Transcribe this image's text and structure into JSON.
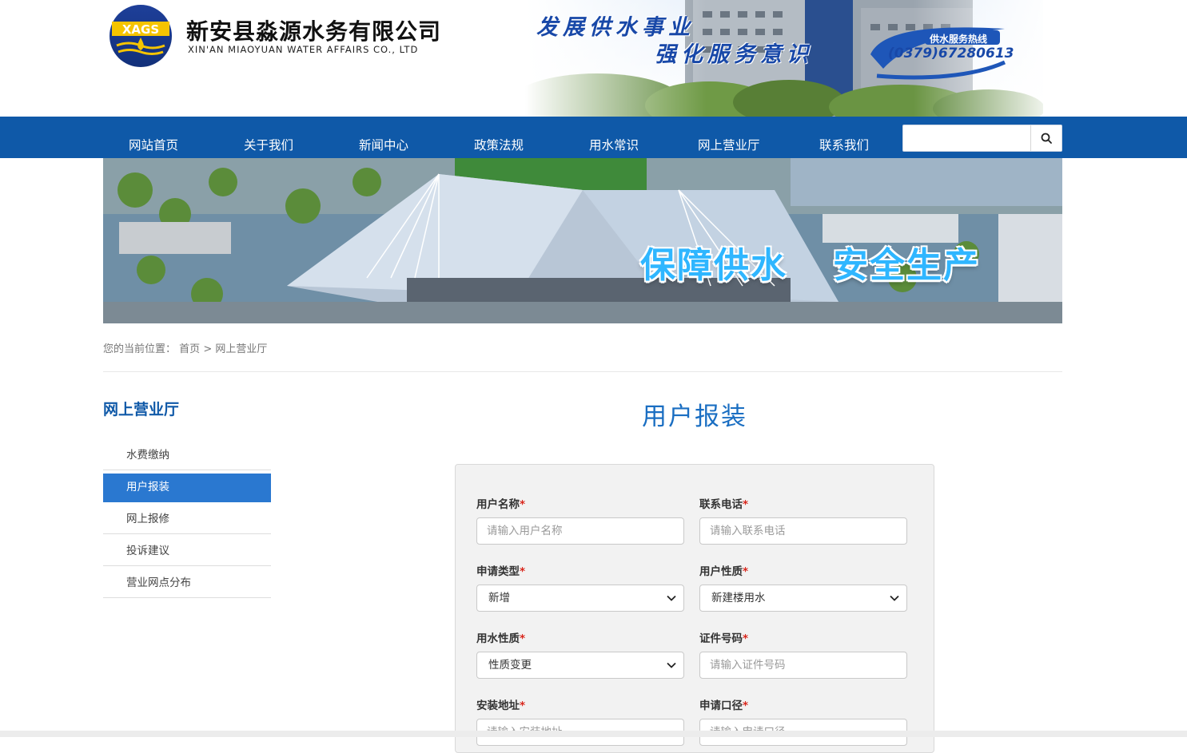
{
  "header": {
    "logo_text": "XAGS",
    "company_cn": "新安县淼源水务有限公司",
    "company_en": "XIN'AN MIAOYUAN WATER AFFAIRS CO., LTD",
    "slogan_line1": "发展供水事业",
    "slogan_line2": "强化服务意识",
    "hotline_label": "供水服务热线",
    "hotline_number": "(0379)67280613"
  },
  "nav": {
    "items": [
      "网站首页",
      "关于我们",
      "新闻中心",
      "政策法规",
      "用水常识",
      "网上营业厅",
      "联系我们"
    ],
    "search_value": "",
    "search_icon": "search-icon"
  },
  "banner": {
    "text_left": "保障供水",
    "text_right": "安全生产"
  },
  "breadcrumb": {
    "prefix": "您的当前位置：",
    "home": "首页",
    "separator": ">",
    "current": "网上营业厅"
  },
  "sidebar": {
    "title": "网上营业厅",
    "items": [
      {
        "label": "水费缴纳",
        "active": false
      },
      {
        "label": "用户报装",
        "active": true
      },
      {
        "label": "网上报修",
        "active": false
      },
      {
        "label": "投诉建议",
        "active": false
      },
      {
        "label": "营业网点分布",
        "active": false
      }
    ]
  },
  "main": {
    "title": "用户报装",
    "required_mark": "*",
    "form": {
      "user_name": {
        "label": "用户名称",
        "placeholder": "请输入用户名称",
        "value": ""
      },
      "phone": {
        "label": "联系电话",
        "placeholder": "请输入联系电话",
        "value": ""
      },
      "apply_type": {
        "label": "申请类型",
        "selected": "新增"
      },
      "user_nature": {
        "label": "用户性质",
        "selected": "新建楼用水"
      },
      "water_nature": {
        "label": "用水性质",
        "selected": "性质变更"
      },
      "id_number": {
        "label": "证件号码",
        "placeholder": "请输入证件号码",
        "value": ""
      },
      "address": {
        "label": "安装地址",
        "placeholder": "请输入安装地址",
        "value": ""
      },
      "caliber": {
        "label": "申请口径",
        "placeholder": "请输入申请口径",
        "value": ""
      }
    }
  },
  "colors": {
    "nav_bg": "#0f59a8",
    "accent": "#1a6ec2",
    "sidebar_active": "#2a78d0",
    "required": "#d9261c"
  }
}
